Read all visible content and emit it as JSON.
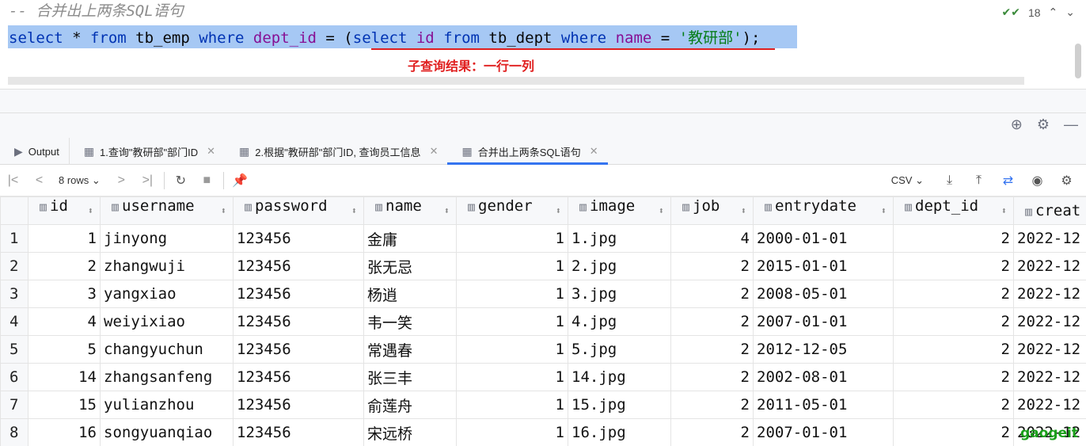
{
  "editor": {
    "comment": "-- 合并出上两条SQL语句",
    "sql": {
      "select1": "select",
      "star": " * ",
      "from1": "from",
      "table1": " tb_emp ",
      "where1": "where",
      "sp1": " ",
      "col1": "dept_id",
      "eq1": " = (",
      "select2": "select",
      "sp2": " ",
      "col2": "id",
      "sp3": " ",
      "from2": "from",
      "table2": " tb_dept ",
      "where2": "where",
      "sp4": " ",
      "col3": "name",
      "eq2": " = ",
      "literal": "'教研部'",
      "tail": ");"
    },
    "annotation": "子查询结果：一行一列",
    "inspection_count": "18"
  },
  "tabs": [
    {
      "label": "Output",
      "icon": "output-icon"
    },
    {
      "label": "1.查询\"教研部\"部门ID",
      "icon": "table-icon"
    },
    {
      "label": "2.根据\"教研部\"部门ID, 查询员工信息",
      "icon": "table-icon"
    },
    {
      "label": "合并出上两条SQL语句",
      "icon": "table-icon",
      "active": true
    }
  ],
  "toolbar": {
    "rows_label": "8 rows",
    "export_format": "CSV"
  },
  "grid": {
    "columns": [
      "id",
      "username",
      "password",
      "name",
      "gender",
      "image",
      "job",
      "entrydate",
      "dept_id",
      "creat"
    ],
    "rows": [
      {
        "rn": "1",
        "id": "1",
        "username": "jinyong",
        "password": "123456",
        "name": "金庸",
        "gender": "1",
        "image": "1.jpg",
        "job": "4",
        "entrydate": "2000-01-01",
        "dept_id": "2",
        "create": "2022-12"
      },
      {
        "rn": "2",
        "id": "2",
        "username": "zhangwuji",
        "password": "123456",
        "name": "张无忌",
        "gender": "1",
        "image": "2.jpg",
        "job": "2",
        "entrydate": "2015-01-01",
        "dept_id": "2",
        "create": "2022-12"
      },
      {
        "rn": "3",
        "id": "3",
        "username": "yangxiao",
        "password": "123456",
        "name": "杨逍",
        "gender": "1",
        "image": "3.jpg",
        "job": "2",
        "entrydate": "2008-05-01",
        "dept_id": "2",
        "create": "2022-12"
      },
      {
        "rn": "4",
        "id": "4",
        "username": "weiyixiao",
        "password": "123456",
        "name": "韦一笑",
        "gender": "1",
        "image": "4.jpg",
        "job": "2",
        "entrydate": "2007-01-01",
        "dept_id": "2",
        "create": "2022-12"
      },
      {
        "rn": "5",
        "id": "5",
        "username": "changyuchun",
        "password": "123456",
        "name": "常遇春",
        "gender": "1",
        "image": "5.jpg",
        "job": "2",
        "entrydate": "2012-12-05",
        "dept_id": "2",
        "create": "2022-12"
      },
      {
        "rn": "6",
        "id": "14",
        "username": "zhangsanfeng",
        "password": "123456",
        "name": "张三丰",
        "gender": "1",
        "image": "14.jpg",
        "job": "2",
        "entrydate": "2002-08-01",
        "dept_id": "2",
        "create": "2022-12"
      },
      {
        "rn": "7",
        "id": "15",
        "username": "yulianzhou",
        "password": "123456",
        "name": "俞莲舟",
        "gender": "1",
        "image": "15.jpg",
        "job": "2",
        "entrydate": "2011-05-01",
        "dept_id": "2",
        "create": "2022-12"
      },
      {
        "rn": "8",
        "id": "16",
        "username": "songyuanqiao",
        "password": "123456",
        "name": "宋远桥",
        "gender": "1",
        "image": "16.jpg",
        "job": "2",
        "entrydate": "2007-01-01",
        "dept_id": "2",
        "create": "2022-12"
      }
    ]
  },
  "watermark": "gaogeit",
  "colors": {
    "keyword": "#0033b3",
    "identifier": "#871094",
    "string": "#067d17",
    "selection": "#a6c8f4",
    "annotation": "#e02020",
    "tab_accent": "#3574f0"
  }
}
